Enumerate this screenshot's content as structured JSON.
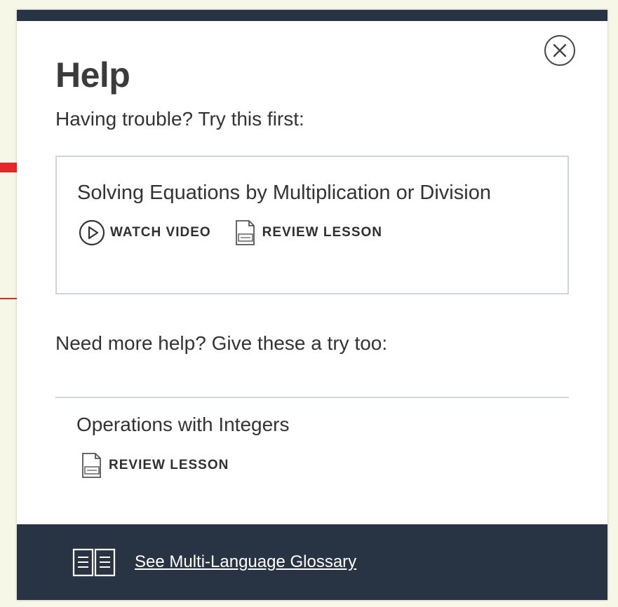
{
  "dialog": {
    "title": "Help",
    "subtitle": "Having trouble? Try this first:"
  },
  "primary": {
    "resource_title": "Solving Equations by Multiplication or Division",
    "watch_video_label": "WATCH VIDEO",
    "review_lesson_label": "REVIEW LESSON"
  },
  "more_help": {
    "heading": "Need more help? Give these a try too:",
    "items": [
      {
        "title": "Operations with Integers",
        "review_lesson_label": "REVIEW LESSON"
      }
    ]
  },
  "footer": {
    "glossary_label": "See Multi-Language Glossary"
  },
  "icons": [
    "close-icon",
    "play-icon",
    "pdf-icon",
    "book-icon"
  ],
  "colors": {
    "header_footer": "#283444",
    "box_border": "#cfd4d9",
    "background": "#f7f7e8",
    "accent_red": "#e22a2a"
  }
}
